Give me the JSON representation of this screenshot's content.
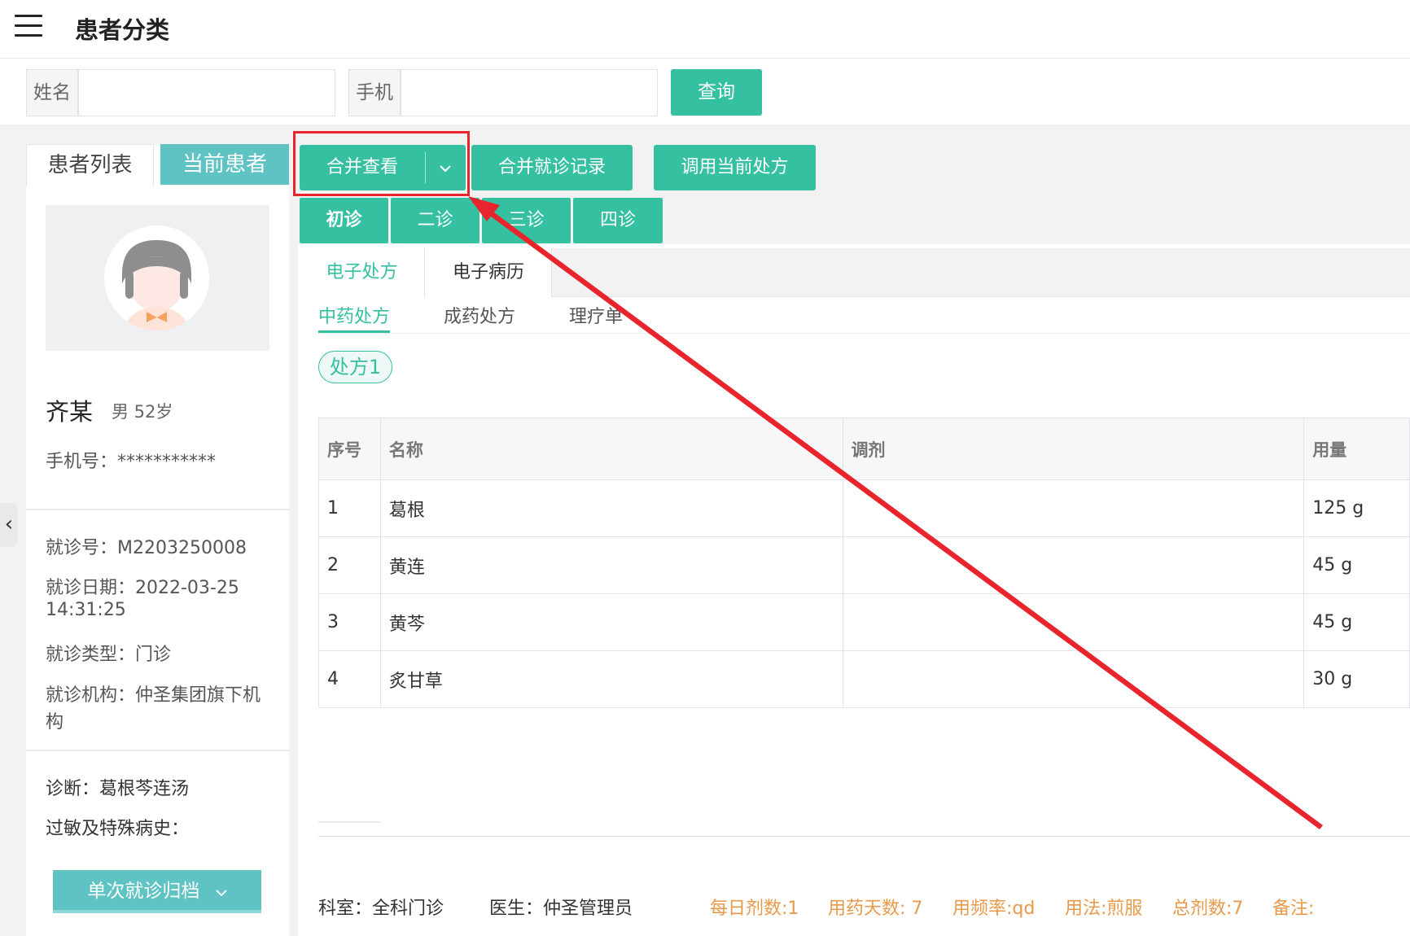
{
  "header": {
    "title": "患者分类"
  },
  "search": {
    "name_label": "姓名",
    "name_value": "",
    "phone_label": "手机",
    "phone_value": "",
    "query_label": "查询"
  },
  "left_panel": {
    "tabs": [
      "患者列表",
      "当前患者"
    ],
    "patient": {
      "name": "齐某",
      "gender_age": "男 52岁",
      "phone": "手机号：***********"
    },
    "visit": {
      "visit_no": "就诊号：M2203250008",
      "visit_date": "就诊日期：2022-03-25",
      "visit_time": "14:31:25",
      "visit_type": "就诊类型：门诊",
      "org_line1": "就诊机构：仲圣集团旗下机",
      "org_line2": "构"
    },
    "diagnosis": "诊断：葛根芩连汤",
    "allergy": "过敏及特殊病史：",
    "archive_button": "单次就诊归档"
  },
  "toolbar": {
    "merge_view": "合并查看",
    "merge_records": "合并就诊记录",
    "use_current_rx": "调用当前处方",
    "visits": [
      "初诊",
      "二诊",
      "三诊",
      "四诊"
    ]
  },
  "record_tabs": [
    "电子处方",
    "电子病历"
  ],
  "rx_tabs": [
    "中药处方",
    "成药处方",
    "理疗单"
  ],
  "rx_pill": "处方1",
  "table": {
    "headers": [
      "序号",
      "名称",
      "调剂",
      "用量"
    ],
    "rows": [
      [
        "1",
        "葛根",
        "",
        "125 g"
      ],
      [
        "2",
        "黄连",
        "",
        "45 g"
      ],
      [
        "3",
        "黄芩",
        "",
        "45 g"
      ],
      [
        "4",
        "炙甘草",
        "",
        "30 g"
      ]
    ]
  },
  "footer": {
    "dept": "科室：全科门诊",
    "doctor": "医生：仲圣管理员",
    "daily_doses": "每日剂数:1",
    "days": "用药天数: 7",
    "frequency": "用频率:qd",
    "usage": "用法:煎服",
    "total_doses": "总剂数:7",
    "remark": "备注:"
  },
  "colors": {
    "accent": "#36c0a2",
    "teal_tab": "#5fc3c4",
    "orange": "#e79a4a",
    "highlight": "#e8242c"
  }
}
